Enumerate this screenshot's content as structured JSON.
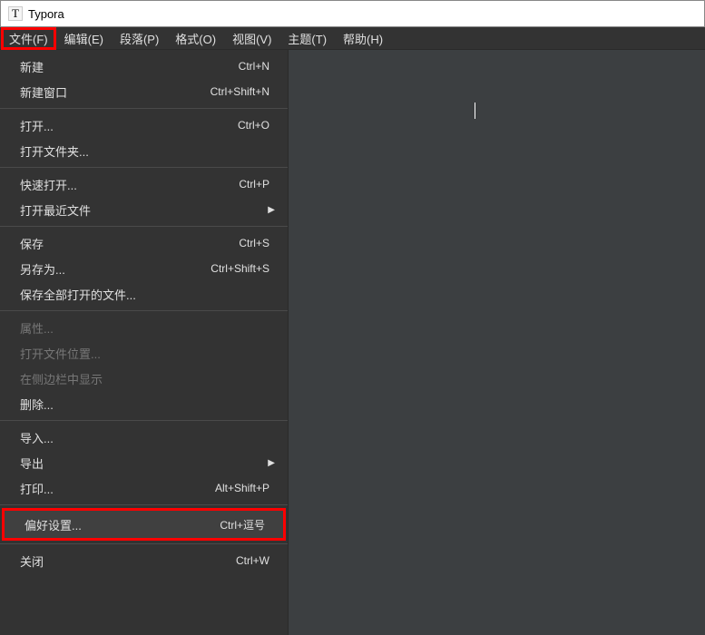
{
  "app": {
    "title": "Typora",
    "icon_letter": "T"
  },
  "menubar": {
    "items": [
      {
        "label": "文件(F)",
        "active": true
      },
      {
        "label": "编辑(E)"
      },
      {
        "label": "段落(P)"
      },
      {
        "label": "格式(O)"
      },
      {
        "label": "视图(V)"
      },
      {
        "label": "主题(T)"
      },
      {
        "label": "帮助(H)"
      }
    ]
  },
  "dropdown": {
    "groups": [
      [
        {
          "label": "新建",
          "shortcut": "Ctrl+N"
        },
        {
          "label": "新建窗口",
          "shortcut": "Ctrl+Shift+N"
        }
      ],
      [
        {
          "label": "打开...",
          "shortcut": "Ctrl+O"
        },
        {
          "label": "打开文件夹..."
        }
      ],
      [
        {
          "label": "快速打开...",
          "shortcut": "Ctrl+P"
        },
        {
          "label": "打开最近文件",
          "submenu": true
        }
      ],
      [
        {
          "label": "保存",
          "shortcut": "Ctrl+S"
        },
        {
          "label": "另存为...",
          "shortcut": "Ctrl+Shift+S"
        },
        {
          "label": "保存全部打开的文件..."
        }
      ],
      [
        {
          "label": "属性...",
          "disabled": true
        },
        {
          "label": "打开文件位置...",
          "disabled": true
        },
        {
          "label": "在侧边栏中显示",
          "disabled": true
        },
        {
          "label": "删除..."
        }
      ],
      [
        {
          "label": "导入..."
        },
        {
          "label": "导出",
          "submenu": true
        },
        {
          "label": "打印...",
          "shortcut": "Alt+Shift+P"
        }
      ],
      [
        {
          "label": "偏好设置...",
          "shortcut": "Ctrl+逗号",
          "highlighted": true,
          "hover": true
        }
      ],
      [
        {
          "label": "关闭",
          "shortcut": "Ctrl+W"
        }
      ]
    ]
  }
}
